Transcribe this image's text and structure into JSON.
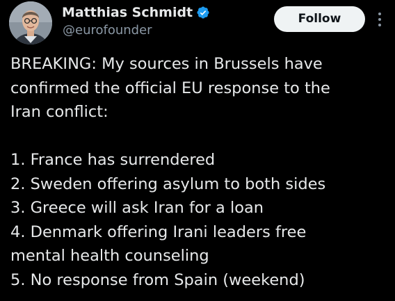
{
  "author": {
    "display_name": "Matthias Schmidt",
    "handle": "@eurofounder",
    "verified": true
  },
  "actions": {
    "follow_label": "Follow"
  },
  "tweet": {
    "lines": [
      "BREAKING: My sources in Brussels have",
      "confirmed the official EU response to the",
      "Iran conflict:",
      "",
      "1. France has surrendered",
      "2. Sweden offering asylum to both sides",
      "3. Greece will ask Iran for a loan",
      "4. Denmark offering Irani leaders free",
      "mental health counseling",
      "5. No response from Spain (weekend)"
    ]
  },
  "colors": {
    "background": "#000000",
    "text_primary": "#e7e9ea",
    "text_secondary": "#8b98a5",
    "verified_badge": "#1d9bf0",
    "follow_button_bg": "#eff3f4",
    "follow_button_text": "#0f1419"
  },
  "icons": {
    "verified": "verified-badge-icon",
    "more": "more-vertical-icon"
  }
}
